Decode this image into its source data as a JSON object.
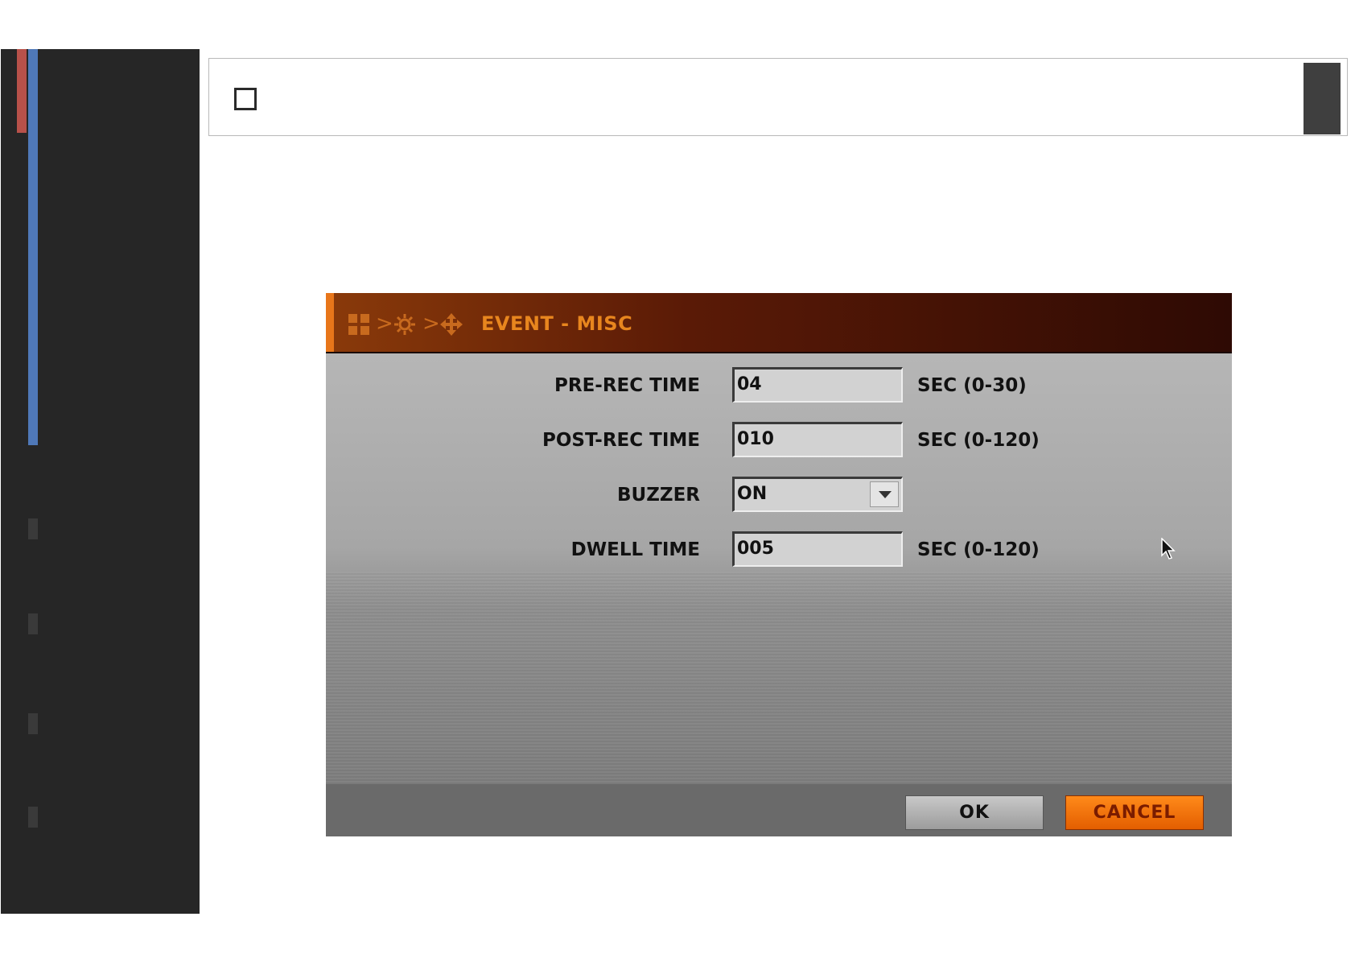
{
  "dialog": {
    "breadcrumb_icons": [
      "grid-icon",
      "gear-icon",
      "move-icon"
    ],
    "breadcrumb_separator": ">",
    "title": "EVENT - MISC",
    "rows": [
      {
        "label": "PRE-REC TIME",
        "value": "04",
        "unit": "SEC (0-30)"
      },
      {
        "label": "POST-REC TIME",
        "value": "010",
        "unit": "SEC (0-120)"
      },
      {
        "label": "BUZZER",
        "value": "ON",
        "unit": ""
      },
      {
        "label": "DWELL TIME",
        "value": "005",
        "unit": "SEC (0-120)"
      }
    ],
    "ok_label": "OK",
    "cancel_label": "CANCEL"
  },
  "colors": {
    "accent": "#e8761a",
    "title_bar_dark": "#2e0a04",
    "cancel_button": "#ff7a00",
    "side_red": "#b8514a",
    "side_blue": "#4f78b8"
  }
}
